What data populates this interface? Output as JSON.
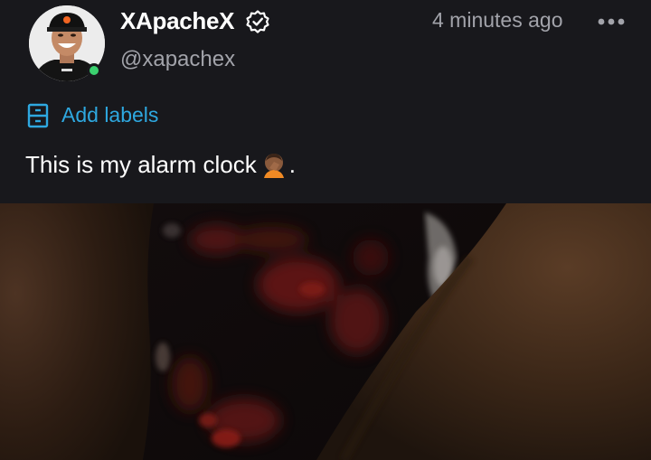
{
  "post": {
    "author": {
      "display_name": "XApacheX",
      "handle": "@xapachex",
      "verified": true,
      "online": true
    },
    "timestamp": "4 minutes ago",
    "labels_action": "Add labels",
    "text": "This is my alarm clock",
    "text_emoji": "face-palm-emoji",
    "text_suffix": "."
  },
  "colors": {
    "background": "#18181c",
    "muted_text": "#a2a3aa",
    "accent": "#2ea8e0",
    "online": "#3bd16f"
  },
  "icons": [
    "verified-badge-icon",
    "more-options-icon",
    "label-icon"
  ]
}
